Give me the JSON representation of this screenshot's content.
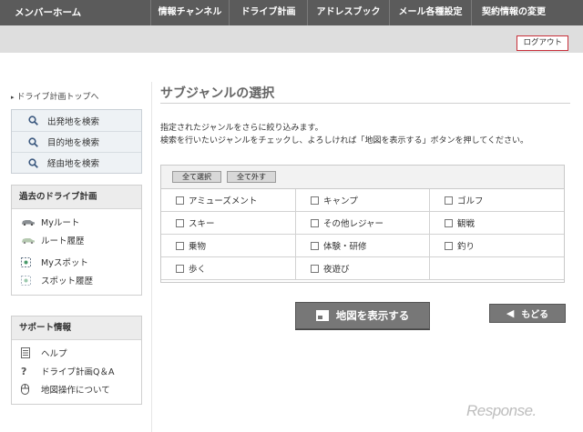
{
  "topnav": {
    "home": "メンバーホーム",
    "items": [
      "情報チャンネル",
      "ドライブ計画",
      "アドレスブック",
      "メール各種設定",
      "契約情報の変更"
    ]
  },
  "logout": "ログアウト",
  "sidebar": {
    "top_link": "ドライブ計画トップへ",
    "search_items": [
      "出発地を検索",
      "目的地を検索",
      "経由地を検索"
    ],
    "history": {
      "title": "過去のドライブ計画",
      "items": [
        "Myルート",
        "ルート履歴",
        "Myスポット",
        "スポット履歴"
      ]
    },
    "support": {
      "title": "サポート情報",
      "items": [
        "ヘルプ",
        "ドライブ計画Q＆A",
        "地図操作について"
      ]
    }
  },
  "main": {
    "title": "サブジャンルの選択",
    "desc1": "指定されたジャンルをさらに絞り込みます。",
    "desc2": "検索を行いたいジャンルをチェックし、よろしければ「地図を表示する」ボタンを押してください。",
    "select_all": "全て選択",
    "deselect_all": "全て外す",
    "genres": [
      "アミューズメント",
      "キャンプ",
      "ゴルフ",
      "スキー",
      "その他レジャー",
      "観戦",
      "乗物",
      "体験・研修",
      "釣り",
      "歩く",
      "夜遊び"
    ],
    "show_map": "地図を表示する",
    "back": "もどる"
  },
  "watermark": "Response."
}
